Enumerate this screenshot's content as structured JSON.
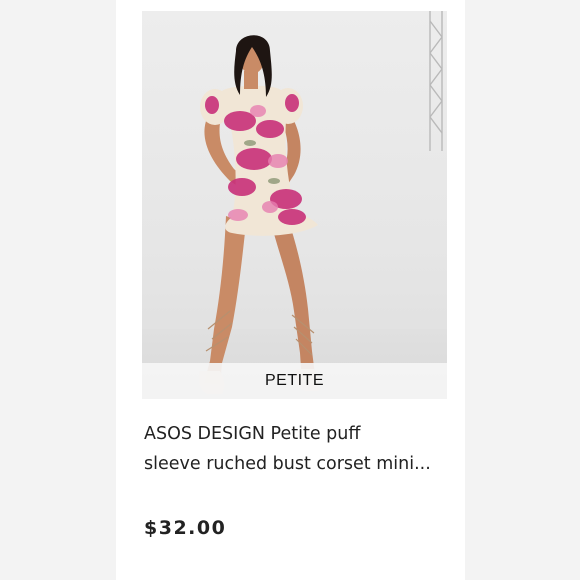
{
  "product": {
    "badge": "PETITE",
    "title_line1": "ASOS DESIGN Petite puff",
    "title_line2": "sleeve ruched bust corset mini...",
    "price": "$32.00"
  },
  "colors": {
    "page_background": "#f3f3f3",
    "card_background": "#ffffff",
    "text": "#222222",
    "dress_base": "#f1e6d6",
    "floral_magenta": "#c8317a",
    "floral_pink": "#e77fb0"
  }
}
